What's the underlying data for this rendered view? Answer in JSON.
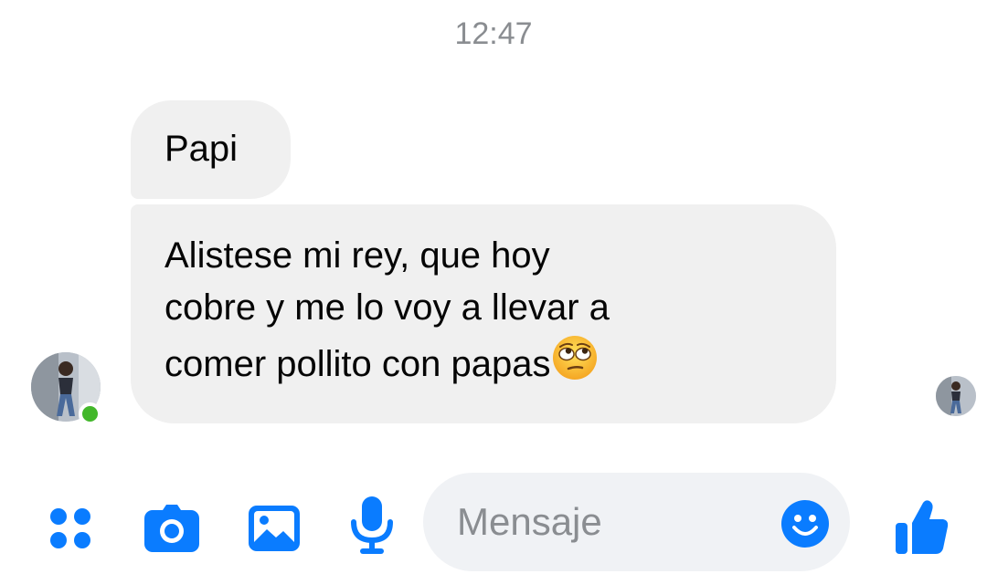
{
  "timestamp": "12:47",
  "messages": [
    {
      "lines": [
        "Papi"
      ]
    },
    {
      "lines": [
        "Alistese mi rey, que hoy",
        "cobre y me lo voy a llevar a",
        "comer pollito con papas"
      ],
      "trailing_emoji": "face-with-rolling-eyes"
    }
  ],
  "sender": {
    "online": true,
    "presence_color": "#42b72a"
  },
  "composer": {
    "placeholder": "Mensaje",
    "icons": [
      "more-actions-icon",
      "camera-icon",
      "gallery-icon",
      "microphone-icon",
      "emoji-icon",
      "thumbs-up-icon"
    ]
  },
  "colors": {
    "accent": "#0a7cff",
    "bubble_bg": "#f0f0f0",
    "text": "#050505",
    "muted": "#8a8d91",
    "composer_bg": "#f0f2f5"
  }
}
